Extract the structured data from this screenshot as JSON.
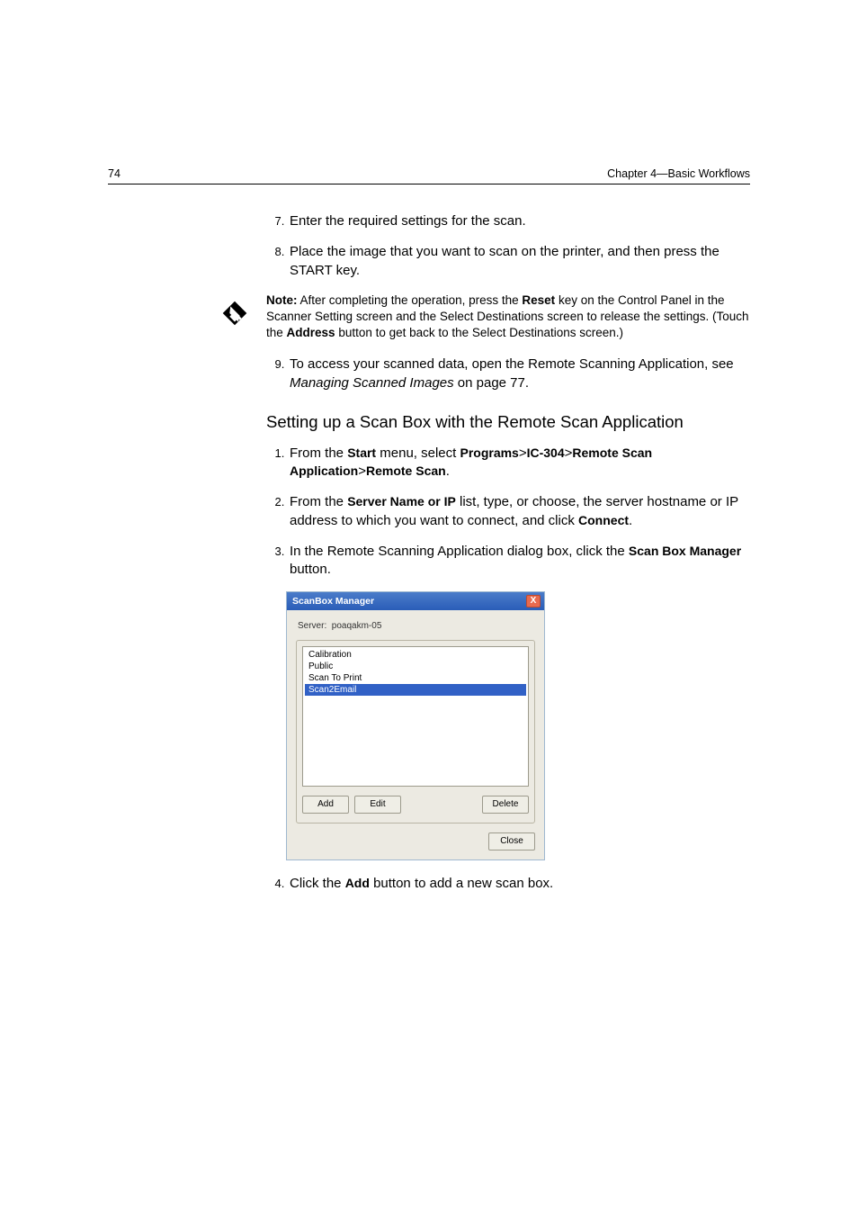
{
  "header": {
    "page_number": "74",
    "chapter": "Chapter 4—Basic Workflows"
  },
  "steps_a": {
    "s7": "Enter the required settings for the scan.",
    "s8": "Place the image that you want to scan on the printer, and then press the START key.",
    "s9_a": "To access your scanned data, open the Remote Scanning Application, see ",
    "s9_i": "Managing Scanned Images",
    "s9_b": " on page 77."
  },
  "note": {
    "label": "Note:",
    "t1": "  After completing the operation, press the ",
    "b1": "Reset",
    "t2": " key on the Control Panel in the Scanner Setting screen and the Select Destinations screen to release the settings. (Touch the ",
    "b2": "Address",
    "t3": " button to get back to the Select Destinations screen.)"
  },
  "subhead": "Setting up a Scan Box with the Remote Scan Application",
  "steps_b": {
    "s1_a": "From the ",
    "s1_b1": "Start",
    "s1_b": " menu, select ",
    "s1_b2": "Programs",
    "s1_gt": ">",
    "s1_b3": "IC-304",
    "s1_b4": "Remote Scan Application",
    "s1_b5": "Remote Scan",
    "s1_end": ".",
    "s2_a": "From the ",
    "s2_b1": "Server Name or IP",
    "s2_b": " list, type, or choose, the server hostname or IP address to which you want to connect, and click ",
    "s2_b2": "Connect",
    "s2_end": ".",
    "s3_a": "In the Remote Scanning Application dialog box, click the ",
    "s3_b1": "Scan Box Manager",
    "s3_b": " button.",
    "s4_a": "Click the ",
    "s4_b1": "Add",
    "s4_b": " button to add a new scan box."
  },
  "dialog": {
    "title": "ScanBox Manager",
    "close_x": "X",
    "server_label": "Server:",
    "server_value": "poaqakm-05",
    "items": {
      "i0": "Calibration",
      "i1": "Public",
      "i2": "Scan To Print",
      "i3": "Scan2Email"
    },
    "btn_add": "Add",
    "btn_edit": "Edit",
    "btn_delete": "Delete",
    "btn_close": "Close"
  }
}
